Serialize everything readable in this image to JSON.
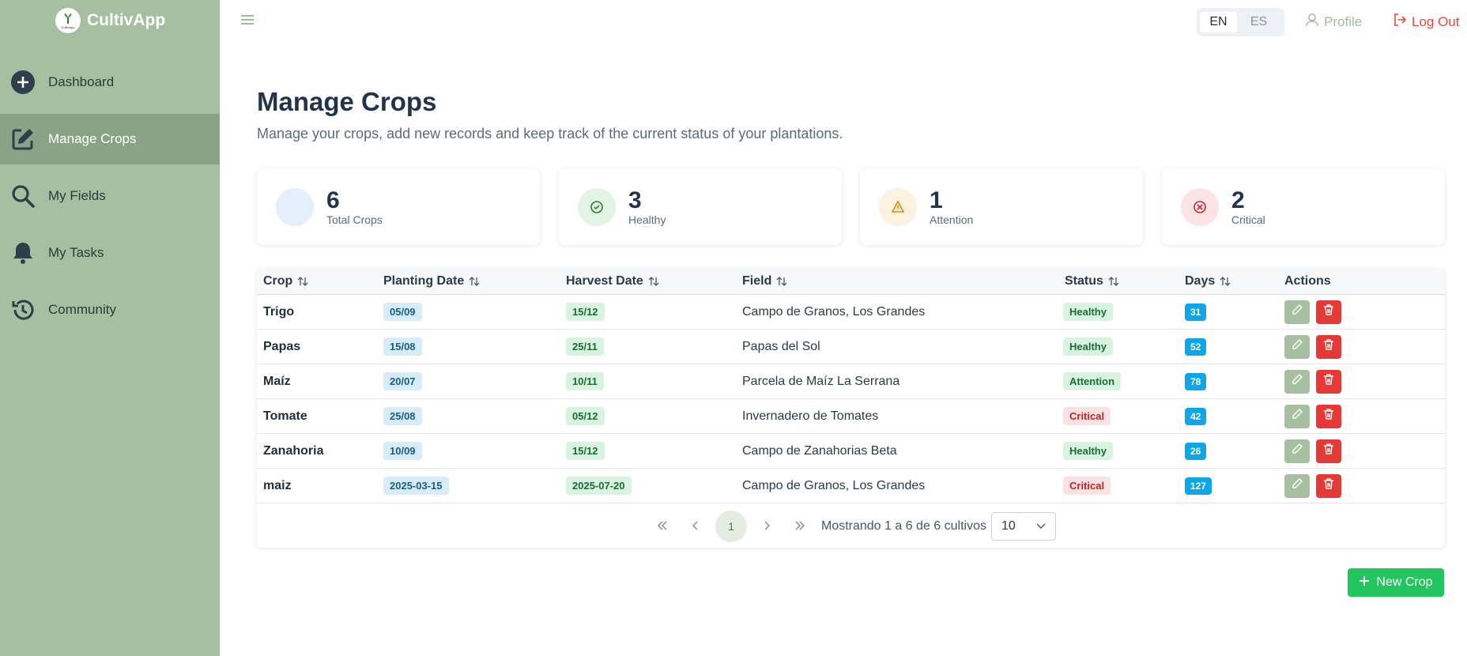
{
  "app": {
    "name": "CultivApp",
    "logo_text": "CultivApp"
  },
  "sidebar": {
    "items": [
      {
        "label": "Dashboard",
        "icon": "plus-circle-icon"
      },
      {
        "label": "Manage Crops",
        "icon": "edit-icon",
        "active": true
      },
      {
        "label": "My Fields",
        "icon": "search-icon"
      },
      {
        "label": "My Tasks",
        "icon": "bell-icon"
      },
      {
        "label": "Community",
        "icon": "history-icon"
      }
    ]
  },
  "header": {
    "languages": [
      "EN",
      "ES"
    ],
    "active_language": "EN",
    "profile_label": "Profile",
    "logout_label": "Log Out"
  },
  "page": {
    "title": "Manage Crops",
    "subtitle": "Manage your crops, add new records and keep track of the current status of your plantations."
  },
  "stats": [
    {
      "value": "6",
      "label": "Total Crops"
    },
    {
      "value": "3",
      "label": "Healthy"
    },
    {
      "value": "1",
      "label": "Attention"
    },
    {
      "value": "2",
      "label": "Critical"
    }
  ],
  "table": {
    "headers": {
      "crop": "Crop",
      "planting": "Planting Date",
      "harvest": "Harvest Date",
      "field": "Field",
      "status": "Status",
      "days": "Days",
      "actions": "Actions"
    },
    "rows": [
      {
        "crop": "Trigo",
        "planting": "05/09",
        "harvest": "15/12",
        "field": "Campo de Granos, Los Grandes",
        "status": "Healthy",
        "days": "31"
      },
      {
        "crop": "Papas",
        "planting": "15/08",
        "harvest": "25/11",
        "field": "Papas del Sol",
        "status": "Healthy",
        "days": "52"
      },
      {
        "crop": "Maíz",
        "planting": "20/07",
        "harvest": "10/11",
        "field": "Parcela de Maíz La Serrana",
        "status": "Attention",
        "days": "78"
      },
      {
        "crop": "Tomate",
        "planting": "25/08",
        "harvest": "05/12",
        "field": "Invernadero de Tomates",
        "status": "Critical",
        "days": "42"
      },
      {
        "crop": "Zanahoria",
        "planting": "10/09",
        "harvest": "15/12",
        "field": "Campo de Zanahorias Beta",
        "status": "Healthy",
        "days": "26"
      },
      {
        "crop": "maiz",
        "planting": "2025-03-15",
        "harvest": "2025-07-20",
        "field": "Campo de Granos, Los Grandes",
        "status": "Critical",
        "days": "127"
      }
    ]
  },
  "pagination": {
    "current_page": "1",
    "info": "Mostrando 1 a 6 de 6 cultivos",
    "page_size": "10"
  },
  "new_crop_label": "New Crop",
  "colors": {
    "sidebar_bg": "#a5bfa0",
    "sidebar_active": "#8aa387",
    "primary_green": "#22c55e",
    "danger": "#e53935",
    "days_badge": "#0ea5e9"
  }
}
